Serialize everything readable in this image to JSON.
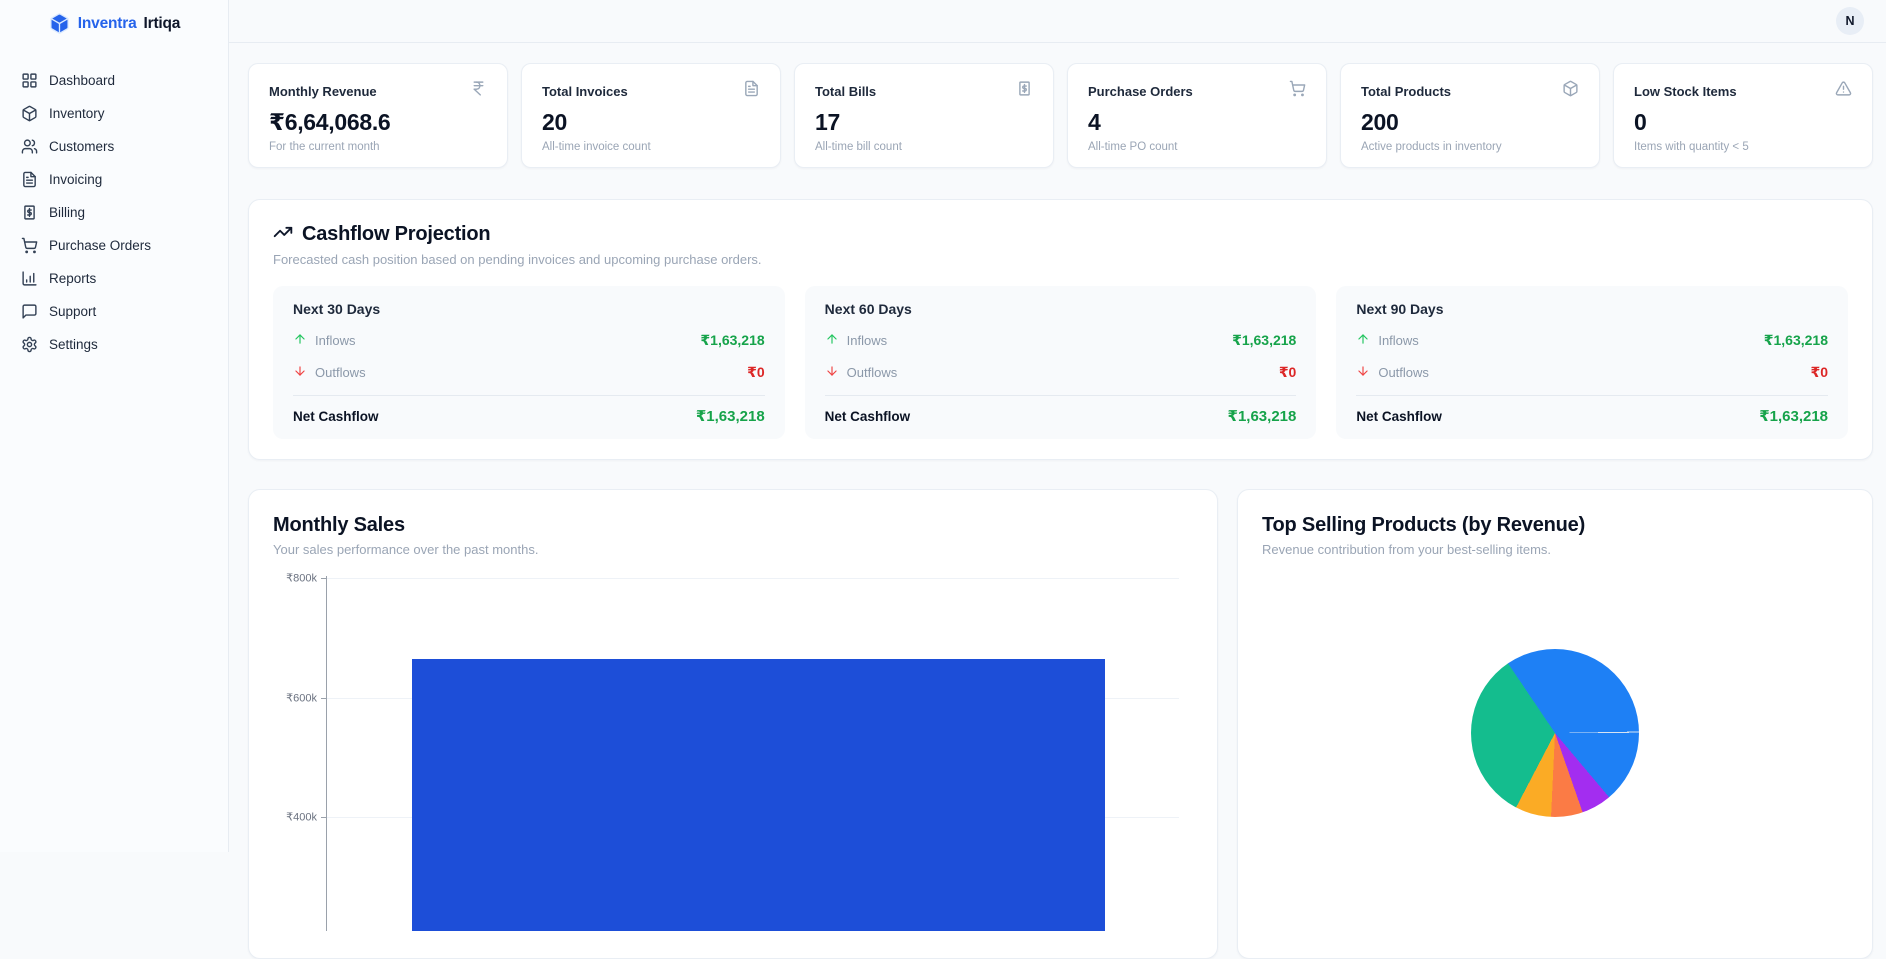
{
  "brand": {
    "primary": "Inventra",
    "secondary": "Irtiqa",
    "logo_icon": "cube-logo-icon",
    "accent_color": "#2563eb"
  },
  "header": {
    "avatar_initial": "N"
  },
  "sidebar": {
    "items": [
      {
        "label": "Dashboard",
        "icon": "dashboard-grid-icon"
      },
      {
        "label": "Inventory",
        "icon": "package-icon"
      },
      {
        "label": "Customers",
        "icon": "users-icon"
      },
      {
        "label": "Invoicing",
        "icon": "file-text-icon"
      },
      {
        "label": "Billing",
        "icon": "receipt-icon"
      },
      {
        "label": "Purchase Orders",
        "icon": "shopping-cart-icon"
      },
      {
        "label": "Reports",
        "icon": "bar-chart-icon"
      },
      {
        "label": "Support",
        "icon": "message-square-icon"
      },
      {
        "label": "Settings",
        "icon": "gear-icon"
      }
    ]
  },
  "stats": [
    {
      "title": "Monthly Revenue",
      "value": "₹6,64,068.6",
      "subtitle": "For the current month",
      "icon": "indian-rupee-icon"
    },
    {
      "title": "Total Invoices",
      "value": "20",
      "subtitle": "All-time invoice count",
      "icon": "file-text-icon"
    },
    {
      "title": "Total Bills",
      "value": "17",
      "subtitle": "All-time bill count",
      "icon": "receipt-icon"
    },
    {
      "title": "Purchase Orders",
      "value": "4",
      "subtitle": "All-time PO count",
      "icon": "shopping-cart-icon"
    },
    {
      "title": "Total Products",
      "value": "200",
      "subtitle": "Active products in inventory",
      "icon": "package-icon"
    },
    {
      "title": "Low Stock Items",
      "value": "0",
      "subtitle": "Items with quantity < 5",
      "icon": "alert-triangle-icon"
    }
  ],
  "cashflow": {
    "title": "Cashflow Projection",
    "title_icon": "trending-up-icon",
    "subtitle": "Forecasted cash position based on pending invoices and upcoming purchase orders.",
    "inflows_label": "Inflows",
    "outflows_label": "Outflows",
    "net_label": "Net Cashflow",
    "periods": [
      {
        "title": "Next 30 Days",
        "inflows": "₹1,63,218",
        "outflows": "₹0",
        "net": "₹1,63,218"
      },
      {
        "title": "Next 60 Days",
        "inflows": "₹1,63,218",
        "outflows": "₹0",
        "net": "₹1,63,218"
      },
      {
        "title": "Next 90 Days",
        "inflows": "₹1,63,218",
        "outflows": "₹0",
        "net": "₹1,63,218"
      }
    ],
    "inflow_color": "#16a34a",
    "outflow_color": "#dc2626"
  },
  "chart_data": [
    {
      "type": "bar",
      "title": "Monthly Sales",
      "subtitle": "Your sales performance over the past months.",
      "categories": [
        ""
      ],
      "series": [
        {
          "name": "Sales",
          "values": [
            664068.6
          ]
        }
      ],
      "ytick_labels": [
        "₹800k",
        "₹600k",
        "₹400k"
      ],
      "ytick_values": [
        800000,
        600000,
        400000
      ],
      "ylim": [
        0,
        800000
      ],
      "grid": true,
      "bar_color": "#1d4ed8"
    },
    {
      "type": "pie",
      "title": "Top Selling Products (by Revenue)",
      "subtitle": "Revenue contribution from your best-selling items.",
      "start_angle_deg": 326,
      "slices": [
        {
          "color": "#1e80f5",
          "percent": 34.4
        },
        {
          "color": "#1e80f5",
          "percent": 13.9
        },
        {
          "color": "#a32df0",
          "percent": 5.8
        },
        {
          "color": "#fb7b45",
          "percent": 6.1
        },
        {
          "color": "#fbab25",
          "percent": 6.9
        },
        {
          "color": "#14bd8e",
          "percent": 32.9
        }
      ],
      "legend": "none"
    }
  ]
}
